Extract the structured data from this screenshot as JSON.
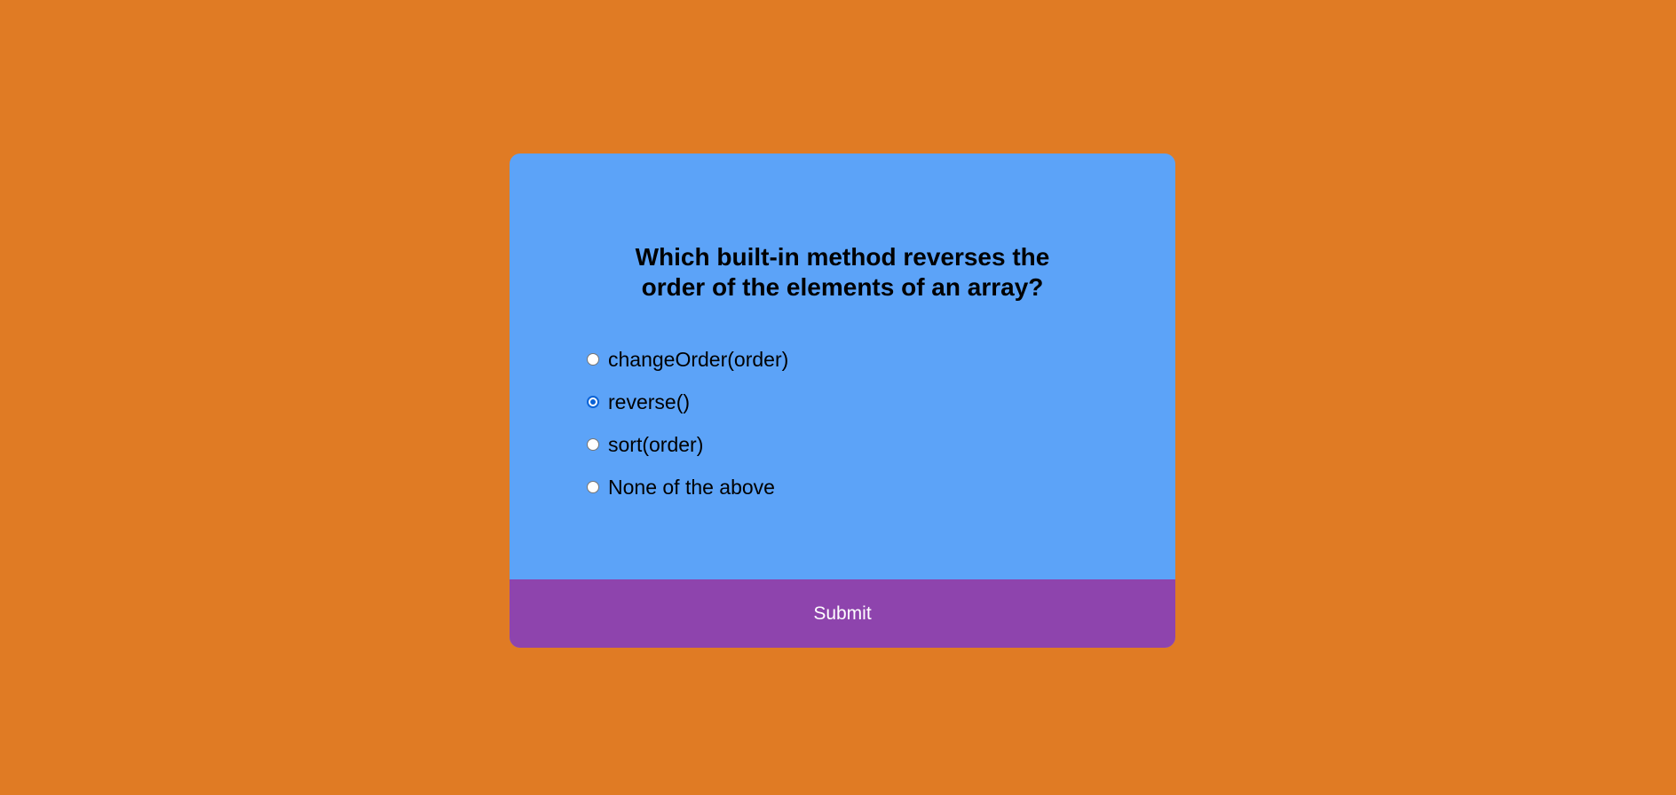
{
  "quiz": {
    "question": "Which built-in method reverses the order of the elements of an array?",
    "answers": [
      {
        "label": "changeOrder(order)",
        "selected": false
      },
      {
        "label": "reverse()",
        "selected": true
      },
      {
        "label": "sort(order)",
        "selected": false
      },
      {
        "label": "None of the above",
        "selected": false
      }
    ],
    "submit_label": "Submit"
  },
  "colors": {
    "background": "#e07b24",
    "card": "#5ca3f8",
    "submit": "#8e44ad"
  }
}
